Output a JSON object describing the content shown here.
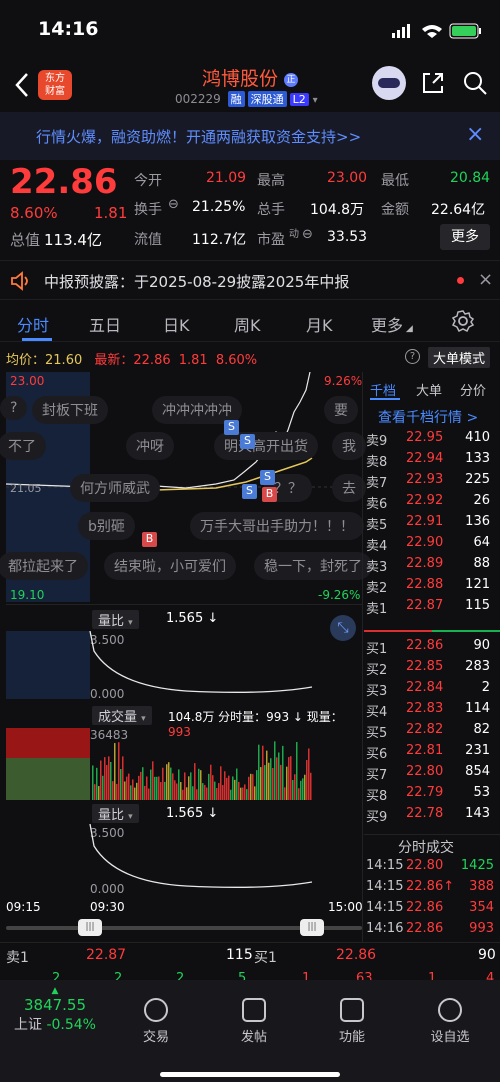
{
  "status_bar": {
    "time": "14:16"
  },
  "header": {
    "back_label": "‹",
    "logo_text": "东方\n财富",
    "title": "鸿博股份",
    "title_badge": "正",
    "code": "002229",
    "tags": [
      "融",
      "深股通",
      "L2"
    ]
  },
  "banner": {
    "text": "行情火爆，融资助燃！开通两融获取资金支持>>",
    "close": "×"
  },
  "quote": {
    "price": "22.86",
    "change_pct": "8.60%",
    "change": "1.81",
    "open_label": "今开",
    "open": "21.09",
    "high_label": "最高",
    "high": "23.00",
    "low_label": "最低",
    "low": "20.84",
    "turnover_label": "换手",
    "turnover": "21.25%",
    "volume_label": "总手",
    "volume": "104.8万",
    "amount_label": "金额",
    "amount": "22.64亿",
    "mktcap_label": "总值",
    "mktcap": "113.4亿",
    "float_label": "流值",
    "float": "112.7亿",
    "pe_label": "市盈",
    "pe_sup": "动",
    "pe": "33.53",
    "more_label": "更多"
  },
  "notice": {
    "text": "中报预披露：于2025-08-29披露2025年中报"
  },
  "tabs": [
    "分时",
    "五日",
    "日K",
    "周K",
    "月K",
    "更多",
    "settings"
  ],
  "chart_header": {
    "avg_label": "均价：",
    "avg": "21.60",
    "last_label": "最新：",
    "last": "22.86",
    "chg": "1.81",
    "chg_pct": "8.60%",
    "mode_label": "大单模式"
  },
  "chart": {
    "y_top": "23.00",
    "y_bottom": "19.10",
    "pct_top": "9.26%",
    "pct_bottom": "-9.26%",
    "y_mid": "21.05"
  },
  "bubbles": [
    "封板下班",
    "冲冲冲冲冲",
    "要",
    "不了",
    "冲呀",
    "明天高开出货",
    "我",
    "何方师威武",
    "？？",
    "去",
    "b别砸",
    "万手大哥出手助力！！！",
    "都拉起来了",
    "结束啦，小可爱们",
    "稳一下，封死了"
  ],
  "volume_ratio_1": {
    "label": "量比",
    "value": "1.565 ↓",
    "ymax": "3.500",
    "ymin": "0.000"
  },
  "volume_panel": {
    "label": "成交量",
    "summary": "104.8万 分时量：993 ↓ 现量：",
    "now": "993",
    "ymax": "36483"
  },
  "volume_ratio_2": {
    "label": "量比",
    "value": "1.565 ↓",
    "ymax": "3.500",
    "ymin": "0.000"
  },
  "x_axis": [
    "09:15",
    "09:30",
    "15:00"
  ],
  "book_tabs": [
    "千档",
    "大单",
    "分价"
  ],
  "book_link": "查看千档行情 >",
  "asks": [
    {
      "label": "卖9",
      "price": "22.95",
      "vol": "410"
    },
    {
      "label": "卖8",
      "price": "22.94",
      "vol": "133"
    },
    {
      "label": "卖7",
      "price": "22.93",
      "vol": "225"
    },
    {
      "label": "卖6",
      "price": "22.92",
      "vol": "26"
    },
    {
      "label": "卖5",
      "price": "22.91",
      "vol": "136"
    },
    {
      "label": "卖4",
      "price": "22.90",
      "vol": "64"
    },
    {
      "label": "卖3",
      "price": "22.89",
      "vol": "88"
    },
    {
      "label": "卖2",
      "price": "22.88",
      "vol": "121"
    },
    {
      "label": "卖1",
      "price": "22.87",
      "vol": "115"
    }
  ],
  "bids": [
    {
      "label": "买1",
      "price": "22.86",
      "vol": "90"
    },
    {
      "label": "买2",
      "price": "22.85",
      "vol": "283"
    },
    {
      "label": "买3",
      "price": "22.84",
      "vol": "2"
    },
    {
      "label": "买4",
      "price": "22.83",
      "vol": "114"
    },
    {
      "label": "买5",
      "price": "22.82",
      "vol": "82"
    },
    {
      "label": "买6",
      "price": "22.81",
      "vol": "231"
    },
    {
      "label": "买7",
      "price": "22.80",
      "vol": "854"
    },
    {
      "label": "买8",
      "price": "22.79",
      "vol": "53"
    },
    {
      "label": "买9",
      "price": "22.78",
      "vol": "143"
    }
  ],
  "trades_title": "分时成交",
  "trades": [
    {
      "time": "14:15",
      "price": "22.80",
      "vol": "1425"
    },
    {
      "time": "14:15",
      "price": "22.86↑",
      "vol": "388"
    },
    {
      "time": "14:15",
      "price": "22.86",
      "vol": "354"
    },
    {
      "time": "14:16",
      "price": "22.86",
      "vol": "993"
    }
  ],
  "bottom_quote": {
    "sell1_label": "卖1",
    "sell1_price": "22.87",
    "sell1_vol": "115",
    "buy1_label": "买1",
    "buy1_price": "22.86",
    "buy1_vol": "90",
    "row2": [
      "2",
      "2",
      "2",
      "5",
      "1",
      "63",
      "1",
      "4"
    ]
  },
  "bottom_nav": {
    "index_value": "3847.55",
    "index_name": "上证",
    "index_chg": "-0.54%",
    "items": [
      "交易",
      "发帖",
      "功能",
      "设自选"
    ]
  }
}
